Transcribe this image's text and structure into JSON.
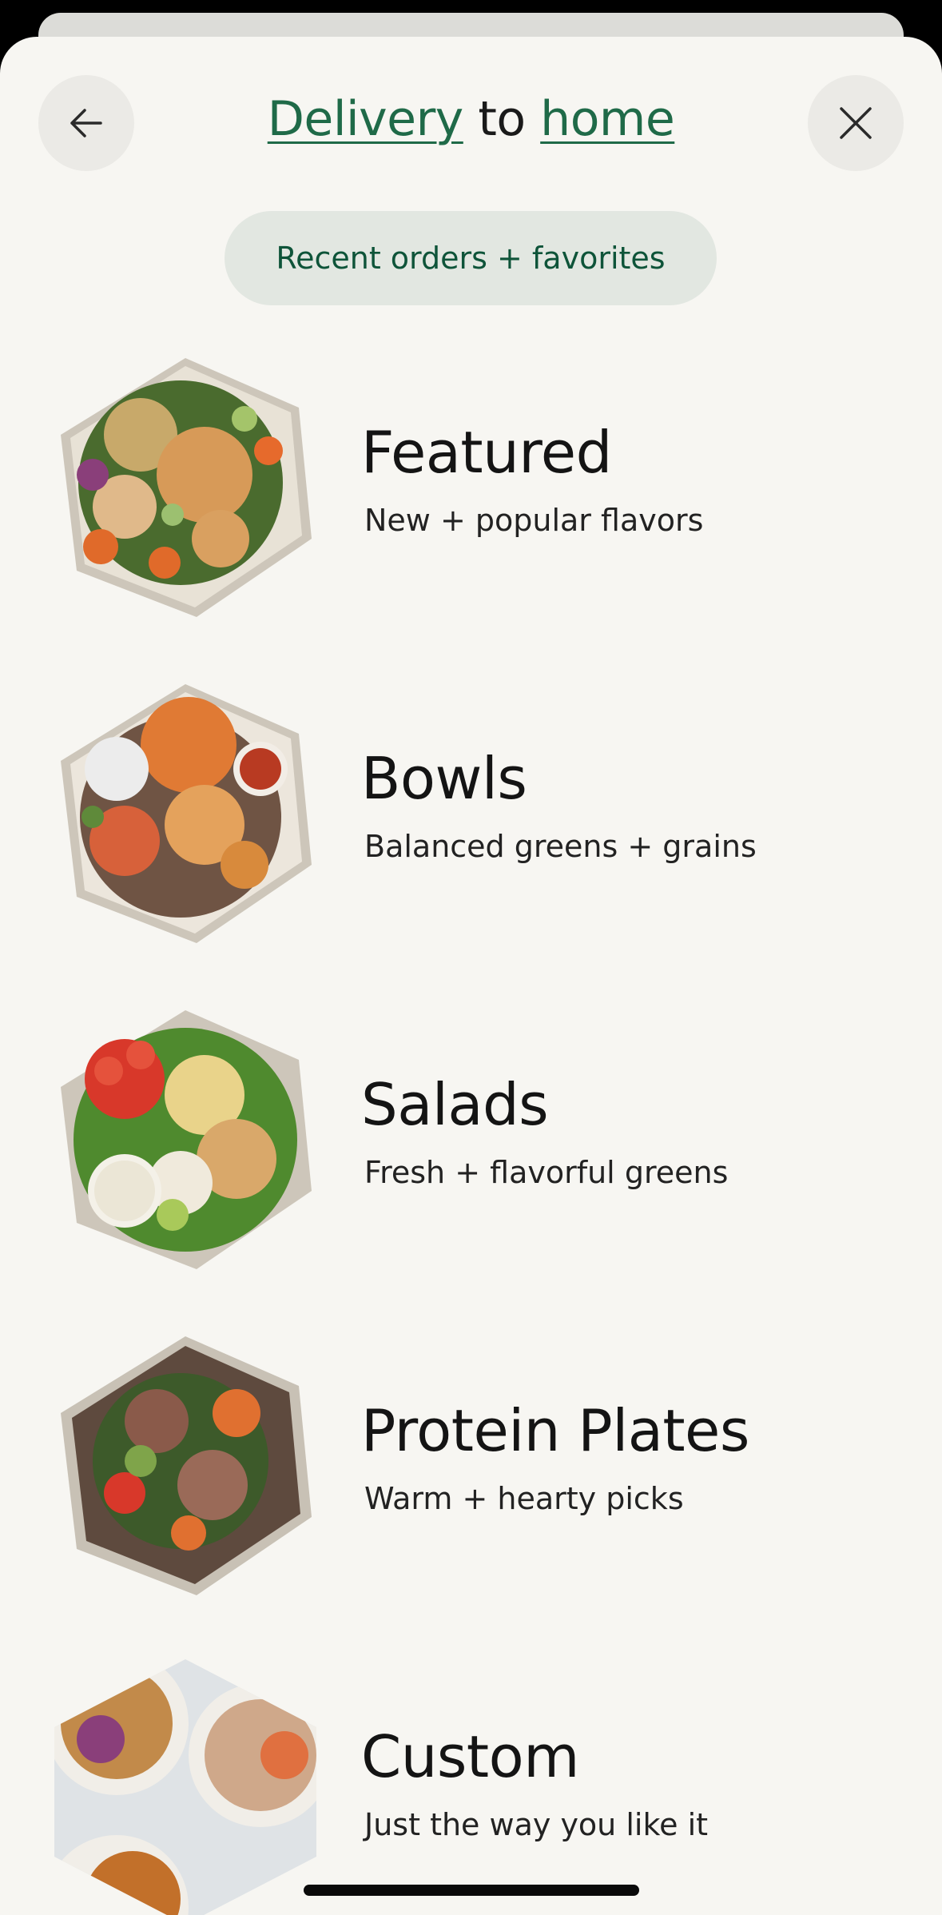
{
  "header": {
    "title_parts": {
      "mode": "Delivery",
      "joiner": " to ",
      "destination": "home"
    },
    "back_icon": "arrow-left-icon",
    "close_icon": "close-icon"
  },
  "pill": {
    "label": "Recent orders + favorites"
  },
  "categories": [
    {
      "name": "Featured",
      "subtitle": "New + popular flavors"
    },
    {
      "name": "Bowls",
      "subtitle": "Balanced greens + grains"
    },
    {
      "name": "Salads",
      "subtitle": "Fresh + flavorful greens"
    },
    {
      "name": "Protein Plates",
      "subtitle": "Warm + hearty picks"
    },
    {
      "name": "Custom",
      "subtitle": "Just the way you like it"
    }
  ],
  "colors": {
    "sheet_bg": "#f7f6f2",
    "accent_green": "#1f6a48",
    "pill_bg": "#e2e7e1",
    "pill_text": "#0e5439"
  }
}
